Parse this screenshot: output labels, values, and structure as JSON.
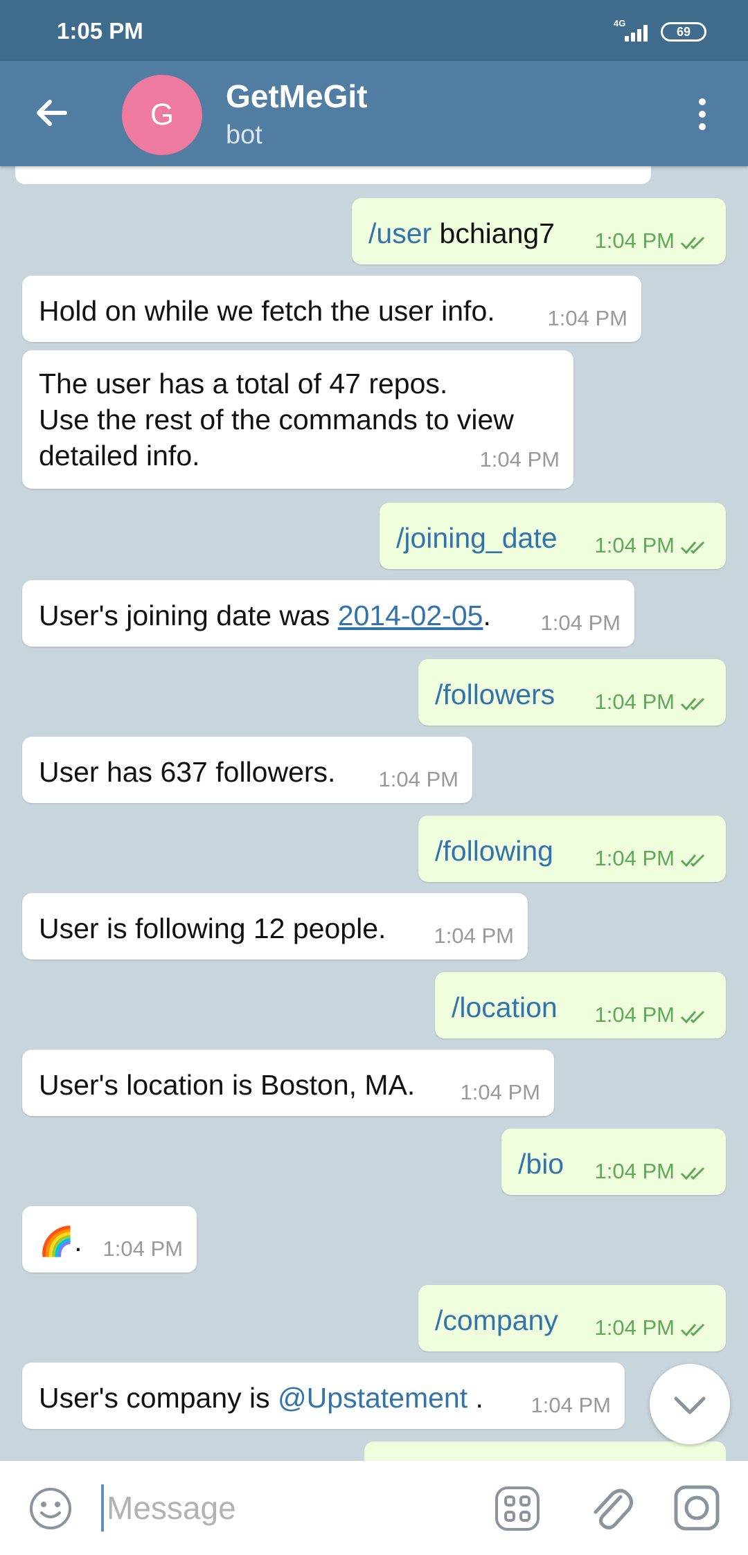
{
  "status_bar": {
    "time": "1:05 PM",
    "network": "4G",
    "battery": "69"
  },
  "header": {
    "back_icon": "arrow-left-icon",
    "avatar_letter": "G",
    "title": "GetMeGit",
    "subtitle": "bot",
    "menu_icon": "more-vertical-icon"
  },
  "messages": [
    {
      "dir": "out",
      "command": "/user",
      "text": " bchiang7",
      "time": "1:04 PM",
      "read": true
    },
    {
      "dir": "in",
      "text": "Hold on while we fetch the user info.",
      "time": "1:04 PM"
    },
    {
      "dir": "in",
      "lines": [
        "The user has a total of 47 repos.",
        "Use the rest of the commands to view",
        "detailed info."
      ],
      "time": "1:04 PM"
    },
    {
      "dir": "out",
      "command": "/joining_date",
      "time": "1:04 PM",
      "read": true
    },
    {
      "dir": "in",
      "text_before": "User's joining date was ",
      "link": "2014-02-05",
      "text_after": ".",
      "time": "1:04 PM"
    },
    {
      "dir": "out",
      "command": "/followers",
      "time": "1:04 PM",
      "read": true
    },
    {
      "dir": "in",
      "text": "User has 637 followers.",
      "time": "1:04 PM"
    },
    {
      "dir": "out",
      "command": "/following",
      "time": "1:04 PM",
      "read": true
    },
    {
      "dir": "in",
      "text": "User is following 12 people.",
      "time": "1:04 PM"
    },
    {
      "dir": "out",
      "command": "/location",
      "time": "1:04 PM",
      "read": true
    },
    {
      "dir": "in",
      "text": "User's location is Boston, MA.",
      "time": "1:04 PM"
    },
    {
      "dir": "out",
      "command": "/bio",
      "time": "1:04 PM",
      "read": true
    },
    {
      "dir": "in",
      "emoji": "🌈",
      "text": ".",
      "time": "1:04 PM"
    },
    {
      "dir": "out",
      "command": "/company",
      "time": "1:04 PM",
      "read": true
    },
    {
      "dir": "in",
      "text_before": "User's company is ",
      "mention": "@Upstatement",
      "text_after": " .",
      "time": "1:04 PM"
    }
  ],
  "input": {
    "placeholder": "Message"
  },
  "icons": {
    "emoji": "smiley-icon",
    "bot_commands": "bot-commands-icon",
    "attach": "paperclip-icon",
    "camera": "camera-icon",
    "scroll": "chevron-down-icon"
  },
  "colors": {
    "header": "#517da2",
    "status_bar": "#3f6b8d",
    "outgoing_bubble": "#effedd",
    "incoming_bubble": "#ffffff",
    "link": "#3273ab",
    "read_check": "#5fa85a"
  }
}
